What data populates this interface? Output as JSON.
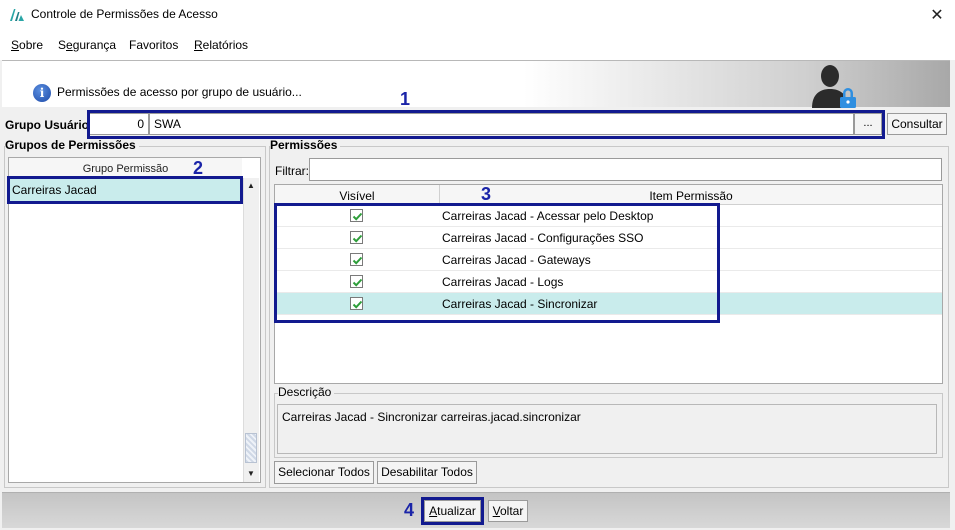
{
  "window": {
    "title": "Controle de Permissões de Acesso",
    "close_glyph": "✕"
  },
  "menu": {
    "items": [
      {
        "label": "Sobre"
      },
      {
        "label": "Segurança"
      },
      {
        "label": "Favoritos"
      },
      {
        "label": "Relatórios"
      }
    ]
  },
  "banner": {
    "text": "Permissões de acesso por grupo de usuário...",
    "info_glyph": "i",
    "icons": [
      "info-icon",
      "user-lock-icon"
    ]
  },
  "group_user": {
    "label": "Grupo Usuário:",
    "id_value": "0",
    "name_value": "SWA",
    "lookup_label": "...",
    "consult_label": "Consultar"
  },
  "groups_panel": {
    "title": "Grupos de Permissões",
    "column_header": "Grupo Permissão",
    "rows": [
      "Carreiras Jacad"
    ],
    "scroll_up": "▲",
    "scroll_down": "▼"
  },
  "permissions_panel": {
    "title": "Permissões",
    "filter_label": "Filtrar:",
    "filter_value": "",
    "columns": [
      "Visível",
      "Item Permissão"
    ],
    "rows": [
      {
        "visible": true,
        "item": "Carreiras Jacad - Acessar pelo Desktop"
      },
      {
        "visible": true,
        "item": "Carreiras Jacad - Configurações SSO"
      },
      {
        "visible": true,
        "item": "Carreiras Jacad - Gateways"
      },
      {
        "visible": true,
        "item": "Carreiras Jacad - Logs"
      },
      {
        "visible": true,
        "item": "Carreiras Jacad - Sincronizar"
      }
    ],
    "description_title": "Descrição",
    "description_value": "Carreiras Jacad - Sincronizar carreiras.jacad.sincronizar",
    "select_all_label": "Selecionar Todos",
    "disable_all_label": "Desabilitar Todos"
  },
  "footer": {
    "update_label": "Atualizar",
    "back_label": "Voltar"
  },
  "annotations": {
    "labels": [
      "1",
      "2",
      "3",
      "4"
    ],
    "color": "#1a24a8"
  },
  "colors": {
    "selection": "#c9ecec",
    "check": "#2e9e3a"
  }
}
